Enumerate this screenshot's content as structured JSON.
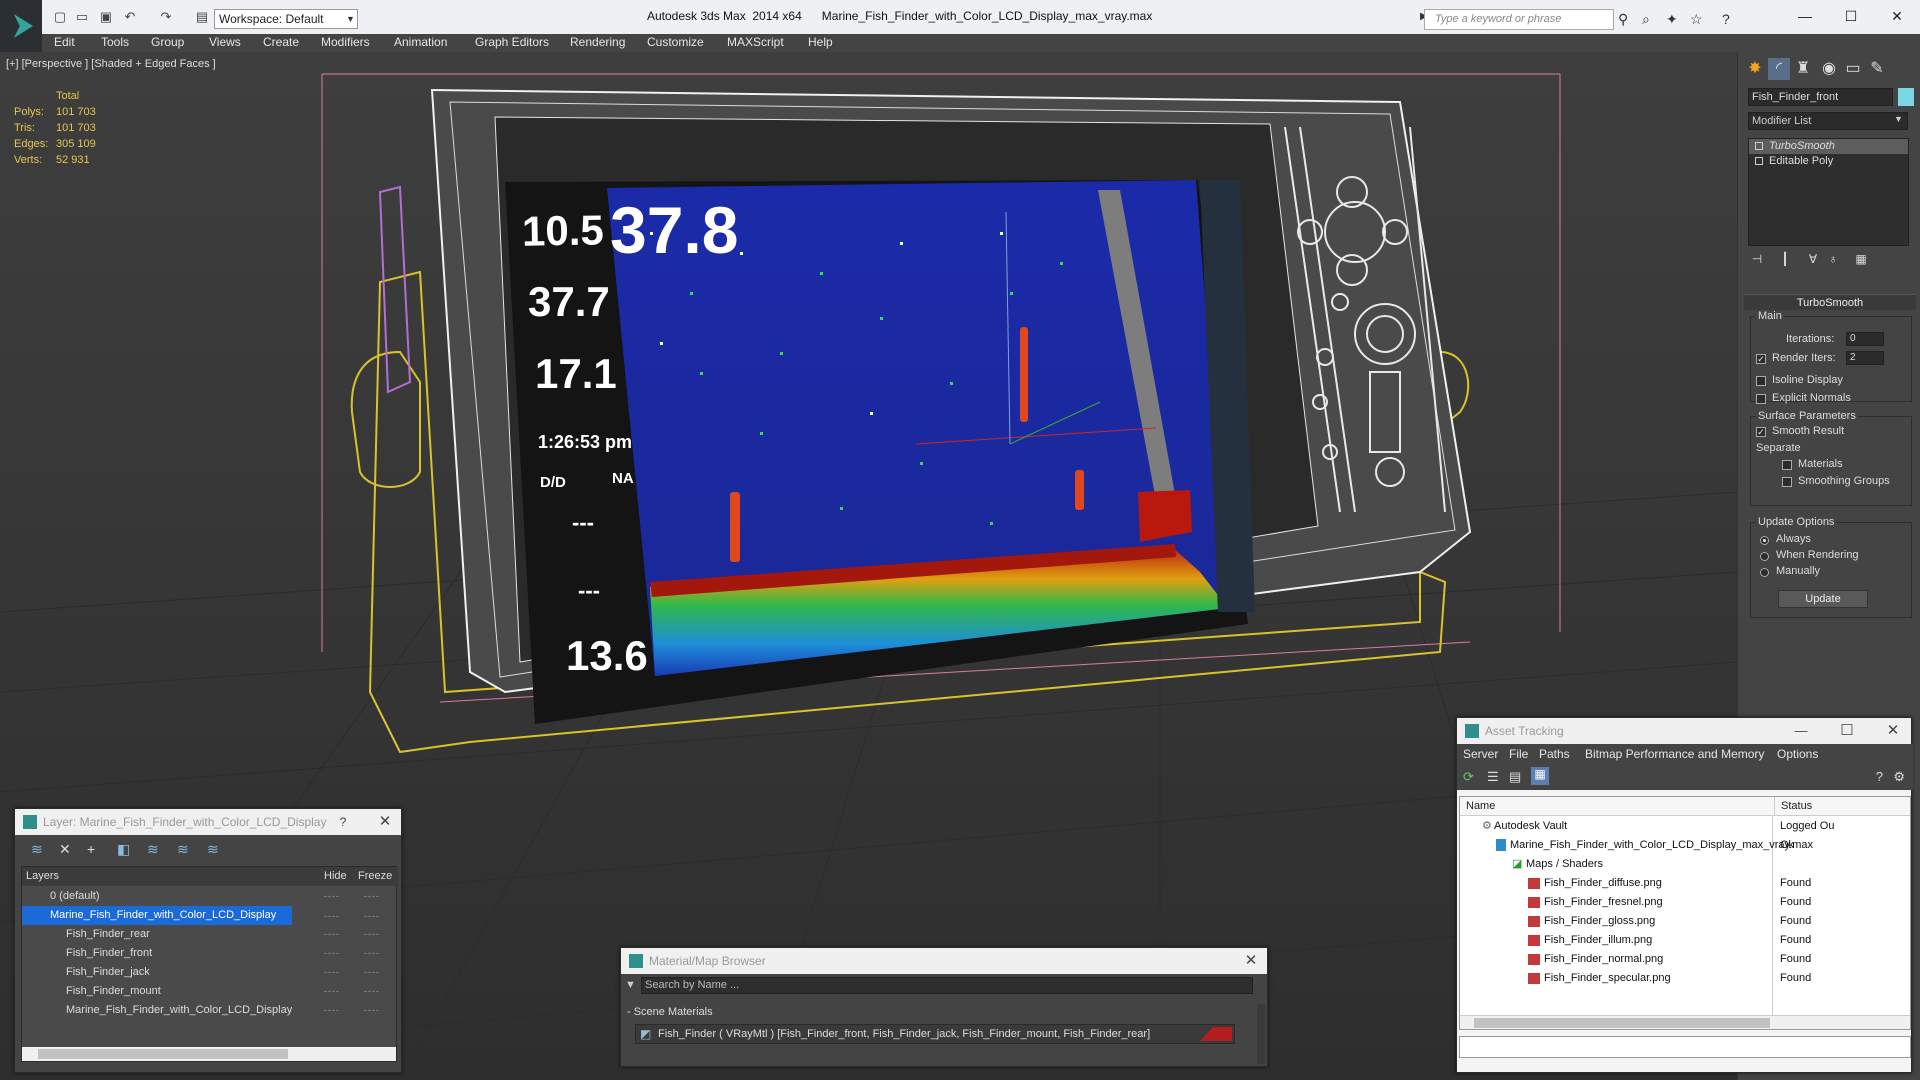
{
  "app": {
    "title_app": "Autodesk 3ds Max  2014 x64",
    "title_file": "Marine_Fish_Finder_with_Color_LCD_Display_max_vray.max",
    "workspace": "Workspace: Default",
    "search_placeholder": "Type a keyword or phrase"
  },
  "menu": [
    "Edit",
    "Tools",
    "Group",
    "Views",
    "Create",
    "Modifiers",
    "Animation",
    "Graph Editors",
    "Rendering",
    "Customize",
    "MAXScript",
    "Help"
  ],
  "viewport": {
    "label": "[+] [Perspective ] [Shaded + Edged Faces ]",
    "stats": {
      "total": "Total",
      "polys_label": "Polys:",
      "polys": "101 703",
      "tris_label": "Tris:",
      "tris": "101 703",
      "edges_label": "Edges:",
      "edges": "305 109",
      "verts_label": "Verts:",
      "verts": "52 931"
    }
  },
  "screen": {
    "depth": "10.5",
    "speed": "37.7",
    "temp": "17.1",
    "time": "1:26:53 pm",
    "dtd": "D/D",
    "dtd_val": "NA",
    "dashes1": "---",
    "dashes2": "---",
    "bottom": "13.6",
    "big": "37.8"
  },
  "command_panel": {
    "object_name": "Fish_Finder_front",
    "object_color": "#7ad8e6",
    "modifier_list": "Modifier List",
    "stack": [
      "TurboSmooth",
      "Editable Poly"
    ],
    "turbosmooth": {
      "title": "TurboSmooth",
      "main": "Main",
      "iterations_label": "Iterations:",
      "iterations": "0",
      "render_iters_label": "Render Iters:",
      "render_iters": "2",
      "isoline": "Isoline Display",
      "explicit": "Explicit Normals",
      "surface": "Surface Parameters",
      "smooth_result": "Smooth Result",
      "separate": "Separate",
      "materials": "Materials",
      "smoothing_groups": "Smoothing Groups",
      "update_options": "Update Options",
      "always": "Always",
      "when_rendering": "When Rendering",
      "manually": "Manually",
      "update": "Update"
    }
  },
  "layer_dialog": {
    "title": "Layer: Marine_Fish_Finder_with_Color_LCD_Display",
    "help": "?",
    "col_layers": "Layers",
    "col_hide": "Hide",
    "col_freeze": "Freeze",
    "rows": [
      "0 (default)",
      "Marine_Fish_Finder_with_Color_LCD_Display",
      "Fish_Finder_rear",
      "Fish_Finder_front",
      "Fish_Finder_jack",
      "Fish_Finder_mount",
      "Marine_Fish_Finder_with_Color_LCD_Display"
    ]
  },
  "material_browser": {
    "title": "Material/Map Browser",
    "search": "Search by Name ...",
    "section": "- Scene Materials",
    "material": "Fish_Finder  ( VRayMtl ) [Fish_Finder_front, Fish_Finder_jack, Fish_Finder_mount, Fish_Finder_rear]"
  },
  "asset_tracking": {
    "title": "Asset Tracking",
    "menu": [
      "Server",
      "File",
      "Paths",
      "Bitmap Performance and Memory",
      "Options"
    ],
    "col_name": "Name",
    "col_status": "Status",
    "rows": [
      {
        "name": "Autodesk Vault",
        "status": "Logged Ou"
      },
      {
        "name": "Marine_Fish_Finder_with_Color_LCD_Display_max_vray.max",
        "status": "Ok"
      },
      {
        "name": "Maps / Shaders",
        "status": ""
      },
      {
        "name": "Fish_Finder_diffuse.png",
        "status": "Found"
      },
      {
        "name": "Fish_Finder_fresnel.png",
        "status": "Found"
      },
      {
        "name": "Fish_Finder_gloss.png",
        "status": "Found"
      },
      {
        "name": "Fish_Finder_illum.png",
        "status": "Found"
      },
      {
        "name": "Fish_Finder_normal.png",
        "status": "Found"
      },
      {
        "name": "Fish_Finder_specular.png",
        "status": "Found"
      }
    ]
  }
}
